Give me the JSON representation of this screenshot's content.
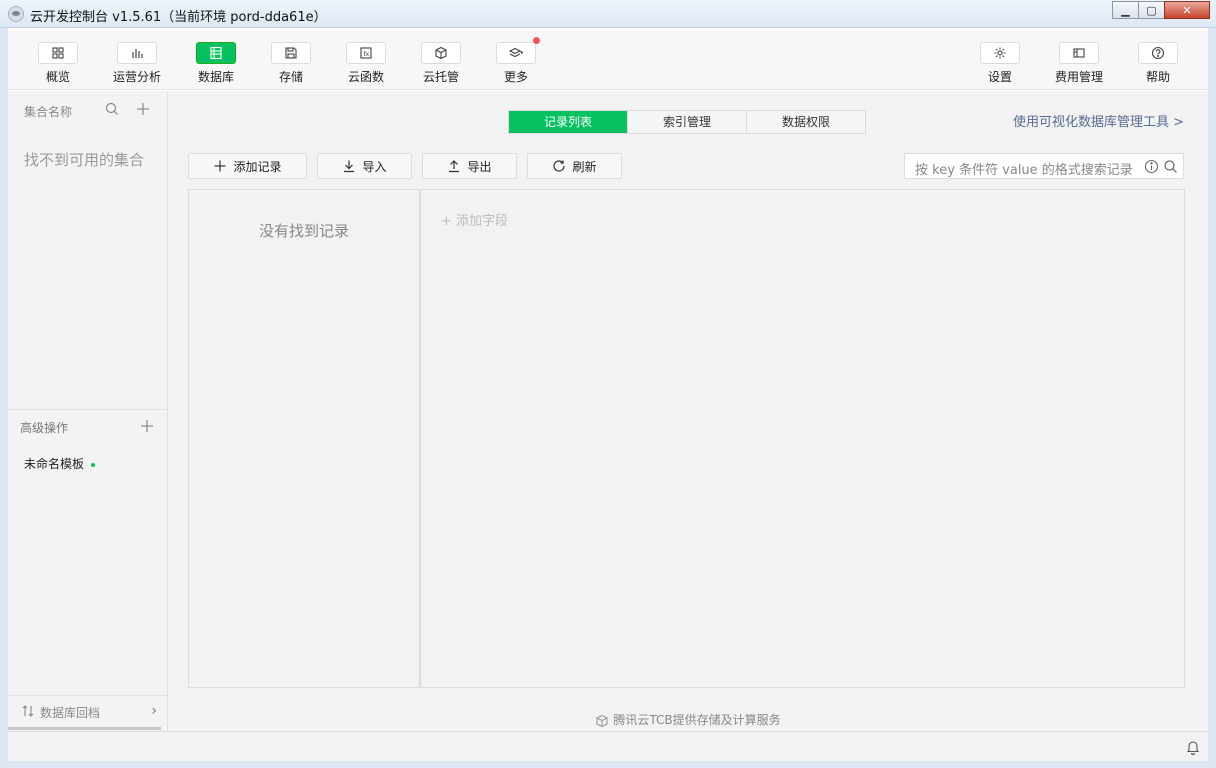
{
  "window": {
    "title": "云开发控制台 v1.5.61（当前环境 pord-dda61e）",
    "minimize": "▁",
    "maximize": "▢",
    "close": "✕"
  },
  "toolbar": {
    "items": [
      {
        "label": "概览",
        "icon": "grid-icon"
      },
      {
        "label": "运营分析",
        "icon": "bar-chart-icon"
      },
      {
        "label": "数据库",
        "icon": "database-icon"
      },
      {
        "label": "存储",
        "icon": "save-icon"
      },
      {
        "label": "云函数",
        "icon": "function-icon"
      },
      {
        "label": "云托管",
        "icon": "cube-icon"
      },
      {
        "label": "更多",
        "icon": "layers-icon"
      },
      {
        "label": "设置",
        "icon": "gear-icon"
      },
      {
        "label": "费用管理",
        "icon": "wallet-icon"
      },
      {
        "label": "帮助",
        "icon": "help-icon"
      }
    ]
  },
  "sidebar": {
    "collections_title": "集合名称",
    "empty_text": "找不到可用的集合",
    "advanced_title": "高级操作",
    "advanced_items": [
      {
        "label": "未命名模板"
      }
    ],
    "rollback_label": "数据库回档"
  },
  "main": {
    "tabs": [
      "记录列表",
      "索引管理",
      "数据权限"
    ],
    "visual_tool_link": "使用可视化数据库管理工具 >",
    "buttons": {
      "add": "添加记录",
      "import": "导入",
      "export": "导出",
      "refresh": "刷新"
    },
    "search_placeholder": "按 key 条件符 value 的格式搜索记录",
    "empty_records": "没有找到记录",
    "add_field": "+  添加字段",
    "footer": "腾讯云TCB提供存储及计算服务"
  },
  "colors": {
    "accent": "#07c160",
    "link": "#576b95",
    "badge": "#f25555"
  }
}
